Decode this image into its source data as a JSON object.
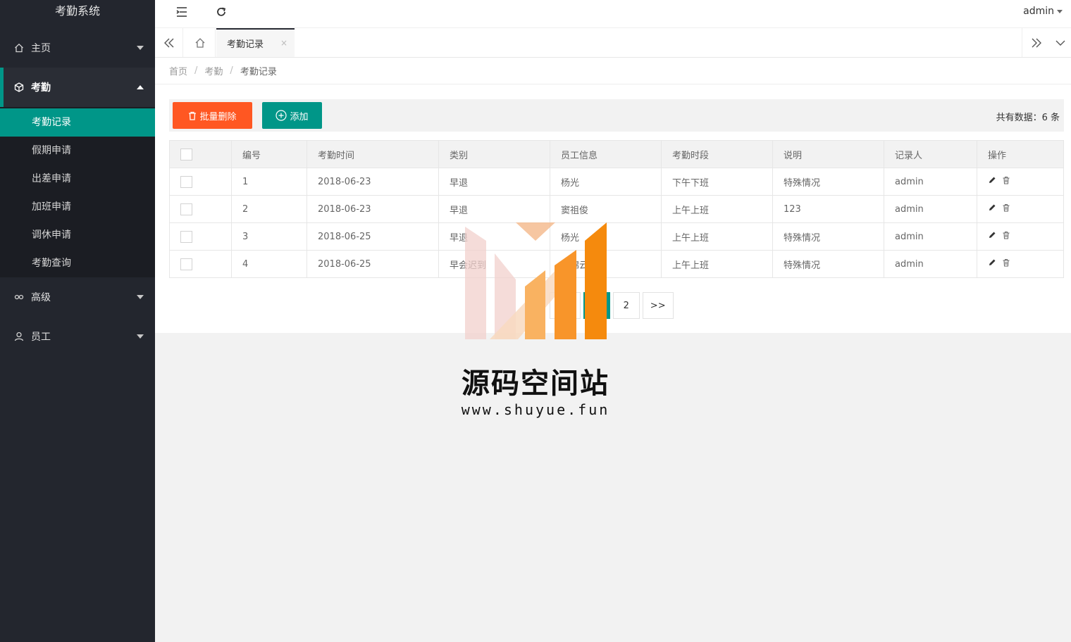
{
  "app": {
    "title": "考勤系统",
    "user": "admin"
  },
  "sidebar": {
    "items": [
      {
        "label": "主页",
        "icon": "home-icon"
      },
      {
        "label": "考勤",
        "icon": "box-icon"
      },
      {
        "label": "高级",
        "icon": "link-icon"
      },
      {
        "label": "员工",
        "icon": "user-icon"
      }
    ],
    "submenu": [
      "考勤记录",
      "假期申请",
      "出差申请",
      "加班申请",
      "调休申请",
      "考勤查询"
    ]
  },
  "tabs": {
    "active": "考勤记录",
    "close": "×"
  },
  "breadcrumb": {
    "home": "首页",
    "section": "考勤",
    "current": "考勤记录",
    "sep": "/"
  },
  "toolbar": {
    "batch_delete": "批量删除",
    "add": "添加",
    "total": "共有数据：6 条"
  },
  "table": {
    "headers": [
      "编号",
      "考勤时间",
      "类别",
      "员工信息",
      "考勤时段",
      "说明",
      "记录人",
      "操作"
    ],
    "rows": [
      {
        "id": "1",
        "time": "2018-06-23",
        "type": "早退",
        "employee": "杨光",
        "period": "下午下班",
        "note": "特殊情况",
        "recorder": "admin"
      },
      {
        "id": "2",
        "time": "2018-06-23",
        "type": "早退",
        "employee": "窦祖俊",
        "period": "上午上班",
        "note": "123",
        "recorder": "admin"
      },
      {
        "id": "3",
        "time": "2018-06-25",
        "type": "早退",
        "employee": "杨光",
        "period": "上午上班",
        "note": "特殊情况",
        "recorder": "admin"
      },
      {
        "id": "4",
        "time": "2018-06-25",
        "type": "早会迟到",
        "employee": "陆锦云",
        "period": "上午上班",
        "note": "特殊情况",
        "recorder": "admin"
      }
    ]
  },
  "pagination": {
    "prev": "<<",
    "current": "1",
    "page2": "2",
    "next": ">>"
  },
  "watermark": {
    "name": "源码空间站",
    "url": "www.shuyue.fun"
  },
  "colors": {
    "accent": "#009688",
    "danger": "#ff5722",
    "sidebar": "#23262e"
  }
}
